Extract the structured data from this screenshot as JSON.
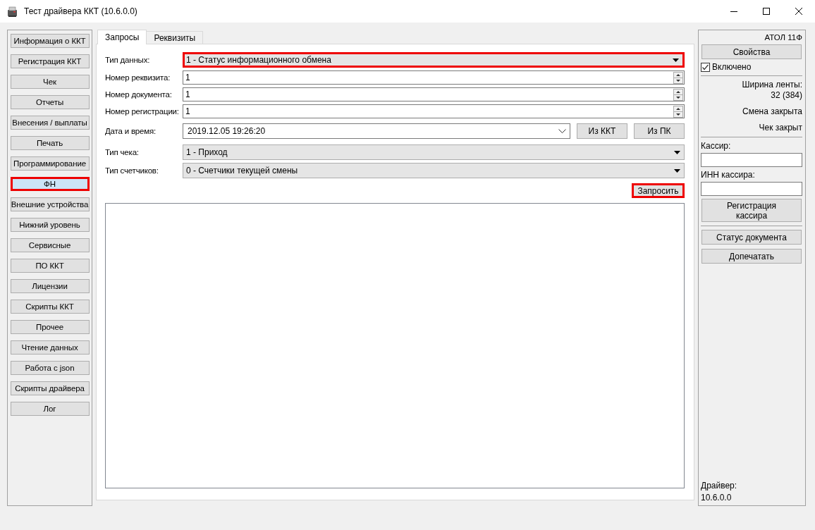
{
  "window": {
    "title": "Тест драйвера ККТ (10.6.0.0)"
  },
  "sidebar": {
    "items": [
      {
        "label": "Информация о ККТ",
        "selected": false,
        "highlighted": false
      },
      {
        "label": "Регистрация ККТ",
        "selected": false,
        "highlighted": false
      },
      {
        "label": "Чек",
        "selected": false,
        "highlighted": false
      },
      {
        "label": "Отчеты",
        "selected": false,
        "highlighted": false
      },
      {
        "label": "Внесения / выплаты",
        "selected": false,
        "highlighted": false
      },
      {
        "label": "Печать",
        "selected": false,
        "highlighted": false
      },
      {
        "label": "Программирование",
        "selected": false,
        "highlighted": false
      },
      {
        "label": "ФН",
        "selected": true,
        "highlighted": true
      },
      {
        "label": "Внешние устройства",
        "selected": false,
        "highlighted": false
      },
      {
        "label": "Нижний уровень",
        "selected": false,
        "highlighted": false
      },
      {
        "label": "Сервисные",
        "selected": false,
        "highlighted": false
      },
      {
        "label": "ПО ККТ",
        "selected": false,
        "highlighted": false
      },
      {
        "label": "Лицензии",
        "selected": false,
        "highlighted": false
      },
      {
        "label": "Скрипты ККТ",
        "selected": false,
        "highlighted": false
      },
      {
        "label": "Прочее",
        "selected": false,
        "highlighted": false
      },
      {
        "label": "Чтение данных",
        "selected": false,
        "highlighted": false
      },
      {
        "label": "Работа с json",
        "selected": false,
        "highlighted": false
      },
      {
        "label": "Скрипты драйвера",
        "selected": false,
        "highlighted": false
      },
      {
        "label": "Лог",
        "selected": false,
        "highlighted": false
      }
    ]
  },
  "tabs": [
    {
      "label": "Запросы",
      "selected": true
    },
    {
      "label": "Реквизиты",
      "selected": false
    }
  ],
  "form": {
    "fields": [
      {
        "kind": "dropdown",
        "label": "Тип данных:",
        "value": "1 - Статус информационного обмена",
        "highlighted": true
      },
      {
        "kind": "spinner",
        "label": "Номер реквизита:",
        "value": "1",
        "highlighted": false
      },
      {
        "kind": "spinner",
        "label": "Номер документа:",
        "value": "1",
        "highlighted": false
      },
      {
        "kind": "spinner",
        "label": "Номер регистрации:",
        "value": "1",
        "highlighted": false
      },
      {
        "kind": "datetime",
        "label": "Дата и время:",
        "value": "2019.12.05 19:26:20",
        "highlighted": false,
        "buttons": [
          "Из ККТ",
          "Из ПК"
        ]
      },
      {
        "kind": "dropdown",
        "label": "Тип чека:",
        "value": "1 - Приход",
        "highlighted": false
      },
      {
        "kind": "dropdown",
        "label": "Тип счетчиков:",
        "value": "0 - Счетчики текущей смены",
        "highlighted": false
      }
    ],
    "request_button": {
      "label": "Запросить",
      "highlighted": true
    }
  },
  "right_panel": {
    "device": "АТОЛ 11Ф",
    "properties_button": "Свойства",
    "enabled": {
      "label": "Включено",
      "checked": true
    },
    "tape_width_label": "Ширина ленты:",
    "tape_width": "32 (384)",
    "shift_status": "Смена закрыта",
    "receipt_status": "Чек закрыт",
    "cashier_label": "Кассир:",
    "cashier_inn_label": "ИНН кассира:",
    "register_cashier_button": "Регистрация кассира",
    "document_status_button": "Статус документа",
    "reprint_button": "Допечатать",
    "driver_label": "Драйвер:",
    "driver_version": "10.6.0.0"
  }
}
